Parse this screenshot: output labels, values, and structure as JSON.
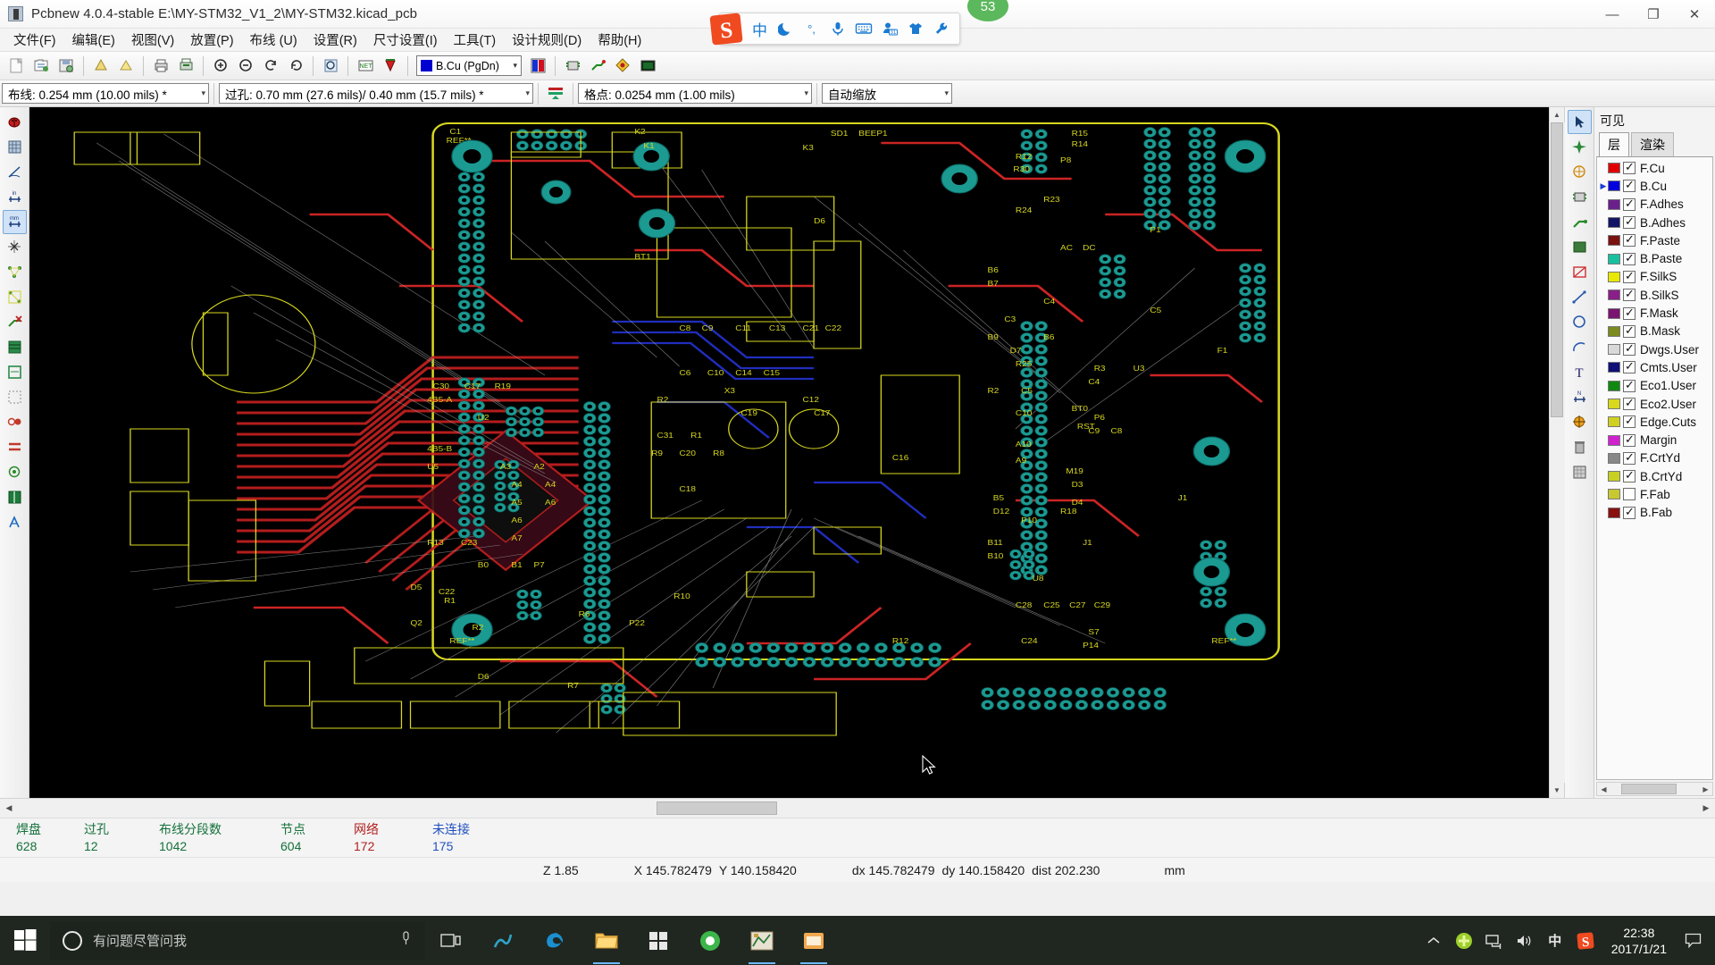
{
  "window": {
    "title": "Pcbnew 4.0.4-stable E:\\MY-STM32_V1_2\\MY-STM32.kicad_pcb",
    "minimize": "—",
    "maximize": "❐",
    "close": "✕"
  },
  "menubar": {
    "items": [
      {
        "label": "文件(F)"
      },
      {
        "label": "编辑(E)"
      },
      {
        "label": "视图(V)"
      },
      {
        "label": "放置(P)"
      },
      {
        "label": "布线 (U)"
      },
      {
        "label": "设置(R)"
      },
      {
        "label": "尺寸设置(I)"
      },
      {
        "label": "工具(T)"
      },
      {
        "label": "设计规则(D)"
      },
      {
        "label": "帮助(H)"
      }
    ]
  },
  "toolbar": {
    "buttons": [
      {
        "name": "new-board-icon"
      },
      {
        "name": "open-board-icon"
      },
      {
        "name": "save-board-icon"
      },
      {
        "name": "board-setup-icon"
      },
      {
        "name": "page-settings-icon"
      },
      {
        "name": "open-library-icon"
      },
      {
        "name": "print-icon"
      },
      {
        "name": "plot-icon"
      },
      {
        "name": "undo-icon"
      },
      {
        "name": "redo-icon"
      },
      {
        "name": "zoom-in-icon"
      },
      {
        "name": "zoom-out-icon"
      },
      {
        "name": "zoom-redraw-icon"
      },
      {
        "name": "zoom-fit-icon"
      },
      {
        "name": "find-icon"
      },
      {
        "name": "netlist-icon"
      },
      {
        "name": "drc-icon"
      },
      {
        "name": "mode-module-icon"
      },
      {
        "name": "mode-track-icon"
      },
      {
        "name": "drc-offswitch-icon"
      },
      {
        "name": "3d-viewer-icon"
      }
    ],
    "layer_selector": {
      "value": "B.Cu (PgDn)",
      "color": "#0000d0",
      "arrow": "▾"
    }
  },
  "settings_bar": {
    "track": {
      "label": "布线: 0.254 mm (10.00 mils) *",
      "arrow": "▾"
    },
    "via": {
      "label": "过孔: 0.70 mm (27.6 mils)/ 0.40 mm (15.7 mils) *",
      "arrow": "▾"
    },
    "grid": {
      "label": "格点: 0.0254 mm (1.00 mils)",
      "arrow": "▾"
    },
    "zoom": {
      "label": "自动缩放",
      "arrow": "▾"
    },
    "autotrack_icon": "auto-track-width-icon"
  },
  "left_toolbar": {
    "buttons": [
      {
        "name": "drc-error-icon"
      },
      {
        "name": "grid-toggle-icon"
      },
      {
        "name": "polar-coord-icon"
      },
      {
        "name": "units-inch-icon"
      },
      {
        "name": "units-mm-icon"
      },
      {
        "name": "cursor-shape-icon"
      },
      {
        "name": "show-ratsnest-icon"
      },
      {
        "name": "show-module-ratsnest-icon"
      },
      {
        "name": "auto-delete-track-icon"
      },
      {
        "name": "show-zones-icon"
      },
      {
        "name": "show-zones-outline-icon"
      },
      {
        "name": "hide-zones-icon"
      },
      {
        "name": "pads-sketch-icon"
      },
      {
        "name": "tracks-sketch-icon"
      },
      {
        "name": "vias-sketch-icon"
      },
      {
        "name": "contrast-mode-icon"
      },
      {
        "name": "toggle-fp-outlines-icon"
      }
    ]
  },
  "right_toolbar": {
    "buttons": [
      {
        "name": "select-cursor-icon"
      },
      {
        "name": "highlight-net-icon"
      },
      {
        "name": "local-ratsnest-icon"
      },
      {
        "name": "add-footprint-icon"
      },
      {
        "name": "add-track-icon"
      },
      {
        "name": "add-zone-icon"
      },
      {
        "name": "add-keepout-icon"
      },
      {
        "name": "add-line-icon"
      },
      {
        "name": "add-circle-icon"
      },
      {
        "name": "add-arc-icon"
      },
      {
        "name": "add-text-icon"
      },
      {
        "name": "add-dimension-icon"
      },
      {
        "name": "add-target-icon"
      },
      {
        "name": "delete-icon"
      },
      {
        "name": "set-origin-icon"
      }
    ]
  },
  "layer_panel": {
    "title": "可见",
    "tabs": [
      {
        "label": "层",
        "active": true
      },
      {
        "label": "渲染",
        "active": false
      }
    ],
    "layers": [
      {
        "name": "F.Cu",
        "color": "#e00000",
        "checked": true,
        "active": false
      },
      {
        "name": "B.Cu",
        "color": "#0000e0",
        "checked": true,
        "active": true
      },
      {
        "name": "F.Adhes",
        "color": "#6b1f8c",
        "checked": true,
        "active": false
      },
      {
        "name": "B.Adhes",
        "color": "#141466",
        "checked": true,
        "active": false
      },
      {
        "name": "F.Paste",
        "color": "#7a1010",
        "checked": true,
        "active": false
      },
      {
        "name": "B.Paste",
        "color": "#18c0a0",
        "checked": true,
        "active": false
      },
      {
        "name": "F.SilkS",
        "color": "#e8e800",
        "checked": true,
        "active": false
      },
      {
        "name": "B.SilkS",
        "color": "#8a1f8a",
        "checked": true,
        "active": false
      },
      {
        "name": "F.Mask",
        "color": "#7a1470",
        "checked": true,
        "active": false
      },
      {
        "name": "B.Mask",
        "color": "#7d8a1c",
        "checked": true,
        "active": false
      },
      {
        "name": "Dwgs.User",
        "color": "#d8d8d8",
        "checked": true,
        "active": false
      },
      {
        "name": "Cmts.User",
        "color": "#101078",
        "checked": true,
        "active": false
      },
      {
        "name": "Eco1.User",
        "color": "#0f8a0f",
        "checked": true,
        "active": false
      },
      {
        "name": "Eco2.User",
        "color": "#d8d81c",
        "checked": true,
        "active": false
      },
      {
        "name": "Edge.Cuts",
        "color": "#d0d020",
        "checked": true,
        "active": false
      },
      {
        "name": "Margin",
        "color": "#d020d0",
        "checked": true,
        "active": false
      },
      {
        "name": "F.CrtYd",
        "color": "#888888",
        "checked": true,
        "active": false
      },
      {
        "name": "B.CrtYd",
        "color": "#c8d020",
        "checked": true,
        "active": false
      },
      {
        "name": "F.Fab",
        "color": "#c8c830",
        "checked": false,
        "active": false
      },
      {
        "name": "B.Fab",
        "color": "#8a1010",
        "checked": true,
        "active": false
      }
    ]
  },
  "status_counts": [
    {
      "label": "焊盘",
      "value": "628",
      "color": "#14713a"
    },
    {
      "label": "过孔",
      "value": "12",
      "color": "#14713a"
    },
    {
      "label": "布线分段数",
      "value": "1042",
      "color": "#14713a"
    },
    {
      "label": "节点",
      "value": "604",
      "color": "#14713a"
    },
    {
      "label": "网络",
      "value": "172",
      "color": "#b02020"
    },
    {
      "label": "未连接",
      "value": "175",
      "color": "#2050c0"
    }
  ],
  "coord_bar": {
    "zoom": "Z 1.85",
    "x": "X 145.782479",
    "y": "Y 140.158420",
    "dx": "dx 145.782479",
    "dy": "dy 140.158420",
    "dist": "dist 202.230",
    "units": "mm"
  },
  "ime": {
    "logo": "sogou-logo-icon",
    "icons": [
      {
        "name": "chinese-mode-icon",
        "glyph": "中"
      },
      {
        "name": "moon-mode-icon",
        "glyph": "🌙"
      },
      {
        "name": "punctuation-icon",
        "glyph": "°,"
      },
      {
        "name": "voice-input-icon",
        "glyph": "🎙"
      },
      {
        "name": "soft-keyboard-icon",
        "glyph": "⌨"
      },
      {
        "name": "toolbox-icon",
        "glyph": "31"
      },
      {
        "name": "skin-icon",
        "glyph": "👕"
      },
      {
        "name": "settings-wrench-icon",
        "glyph": "🔧"
      }
    ]
  },
  "cursor_badge": {
    "value": "53"
  },
  "taskbar": {
    "start": "start-icon",
    "cortana_placeholder": "有问题尽管问我",
    "mic_icon": "microphone-icon",
    "apps": [
      {
        "name": "task-view-icon",
        "running": false
      },
      {
        "name": "groove-music-icon",
        "running": false
      },
      {
        "name": "edge-browser-icon",
        "running": false
      },
      {
        "name": "file-explorer-icon",
        "running": true
      },
      {
        "name": "store-icon",
        "running": false
      },
      {
        "name": "browser-360-icon",
        "running": false
      },
      {
        "name": "kicad-pcbnew-icon",
        "running": true
      },
      {
        "name": "editor-icon",
        "running": true
      }
    ],
    "tray": [
      {
        "name": "show-hidden-icons-chevron",
        "glyph": "︿"
      },
      {
        "name": "antivirus-shield-icon",
        "glyph": "✚"
      },
      {
        "name": "network-icon",
        "glyph": "🖧"
      },
      {
        "name": "volume-icon",
        "glyph": "🔊"
      },
      {
        "name": "ime-chinese-icon",
        "glyph": "中"
      },
      {
        "name": "sogou-tray-icon",
        "glyph": "S"
      }
    ],
    "clock": {
      "time": "22:38",
      "date": "2017/1/21"
    },
    "notification": "notification-icon"
  }
}
